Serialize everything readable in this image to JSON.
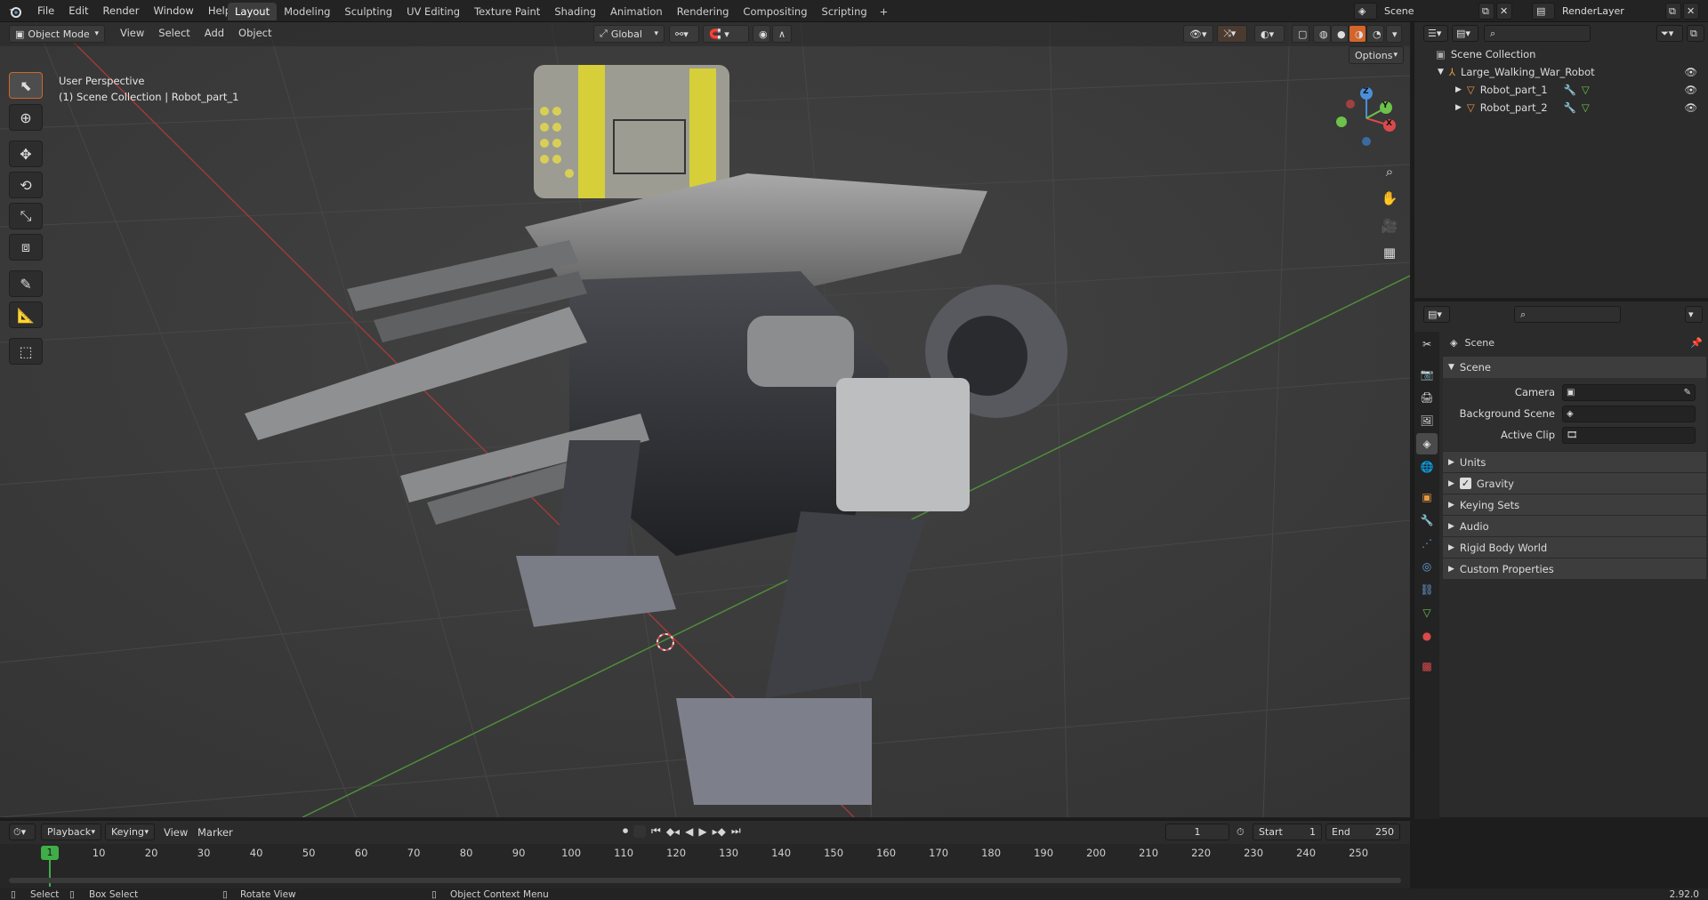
{
  "menus": [
    "File",
    "Edit",
    "Render",
    "Window",
    "Help"
  ],
  "workspace_tabs": [
    {
      "label": "Layout",
      "active": true
    },
    {
      "label": "Modeling",
      "active": false
    },
    {
      "label": "Sculpting",
      "active": false
    },
    {
      "label": "UV Editing",
      "active": false
    },
    {
      "label": "Texture Paint",
      "active": false
    },
    {
      "label": "Shading",
      "active": false
    },
    {
      "label": "Animation",
      "active": false
    },
    {
      "label": "Rendering",
      "active": false
    },
    {
      "label": "Compositing",
      "active": false
    },
    {
      "label": "Scripting",
      "active": false
    }
  ],
  "add_workspace": "+",
  "scene_name": "Scene",
  "view_layer": "RenderLayer",
  "viewport": {
    "mode": "Object Mode",
    "menus": [
      "View",
      "Select",
      "Add",
      "Object"
    ],
    "transform_orientation": "Global",
    "options": "Options",
    "overlay_title": "User Perspective",
    "overlay_subtitle": "(1) Scene Collection | Robot_part_1",
    "axis_labels": {
      "x": "X",
      "y": "Y",
      "z": "Z"
    }
  },
  "outliner": {
    "root": "Scene Collection",
    "items": [
      {
        "label": "Large_Walking_War_Robot",
        "level": 1
      },
      {
        "label": "Robot_part_1",
        "level": 2
      },
      {
        "label": "Robot_part_2",
        "level": 2
      }
    ]
  },
  "properties": {
    "context": "Scene",
    "panel": "Scene",
    "fields": [
      {
        "label": "Camera"
      },
      {
        "label": "Background Scene"
      },
      {
        "label": "Active Clip"
      }
    ],
    "subpanels": [
      "Units",
      "Gravity",
      "Keying Sets",
      "Audio",
      "Rigid Body World",
      "Custom Properties"
    ],
    "gravity_checked": true
  },
  "timeline": {
    "menus": [
      "Playback",
      "Keying",
      "View",
      "Marker"
    ],
    "current_frame": "1",
    "start_label": "Start",
    "start": "1",
    "end_label": "End",
    "end": "250",
    "ticks": [
      "1",
      "10",
      "20",
      "30",
      "40",
      "50",
      "60",
      "70",
      "80",
      "90",
      "100",
      "110",
      "120",
      "130",
      "140",
      "150",
      "160",
      "170",
      "180",
      "190",
      "200",
      "210",
      "220",
      "230",
      "240",
      "250"
    ]
  },
  "statusbar": {
    "select": "Select",
    "box_select": "Box Select",
    "rotate_view": "Rotate View",
    "context_menu": "Object Context Menu",
    "version": "2.92.0"
  },
  "colors": {
    "accent": "#d3652a",
    "axis_x": "#d94a4a",
    "axis_y": "#6cc24a",
    "axis_z": "#4a8fd9",
    "playhead": "#3fae49"
  }
}
